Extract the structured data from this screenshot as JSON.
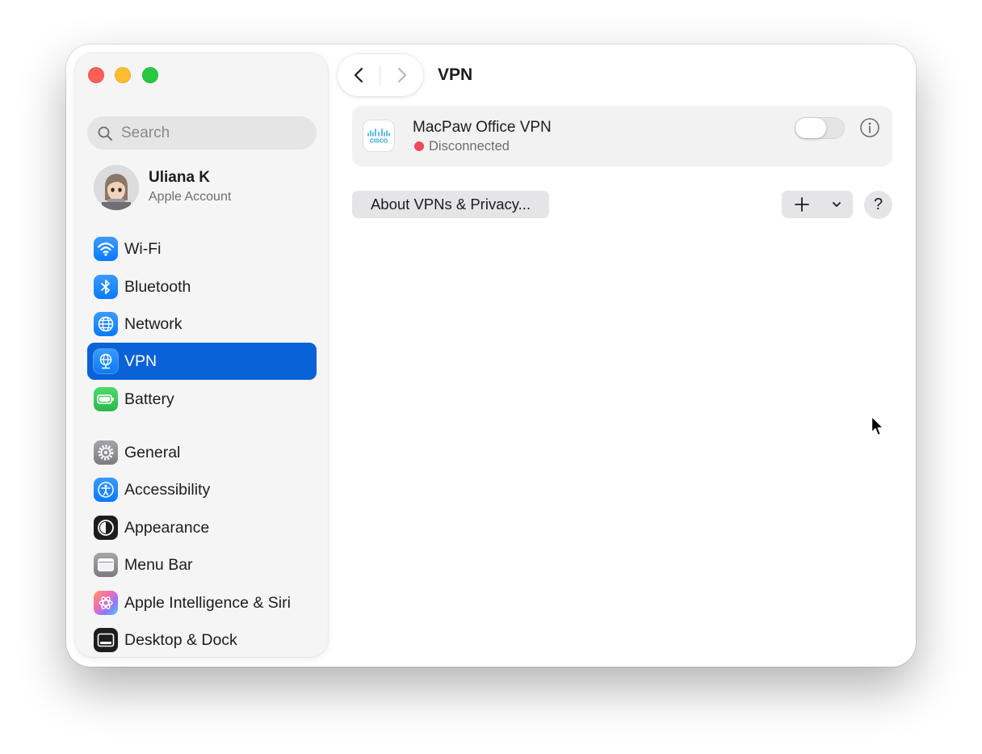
{
  "sidebar": {
    "search_placeholder": "Search",
    "profile": {
      "name": "Uliana K",
      "subtitle": "Apple Account"
    },
    "items": [
      {
        "label": "Wi-Fi",
        "icon": "wifi-icon",
        "color": "#0a84ff"
      },
      {
        "label": "Bluetooth",
        "icon": "bluetooth-icon",
        "color": "#0a84ff"
      },
      {
        "label": "Network",
        "icon": "globe-icon",
        "color": "#0a84ff"
      },
      {
        "label": "VPN",
        "icon": "vpn-globe-icon",
        "color": "#0a84ff",
        "selected": true
      },
      {
        "label": "Battery",
        "icon": "battery-icon",
        "color": "#34c759"
      },
      {
        "label": "General",
        "icon": "gear-icon",
        "color": "#8e8e93"
      },
      {
        "label": "Accessibility",
        "icon": "accessibility-icon",
        "color": "#0a84ff"
      },
      {
        "label": "Appearance",
        "icon": "appearance-icon",
        "color": "#1d1d1f"
      },
      {
        "label": "Menu Bar",
        "icon": "menu-bar-icon",
        "color": "#8e8e93"
      },
      {
        "label": "Apple Intelligence & Siri",
        "icon": "siri-icon",
        "color": "#e8a0d8"
      },
      {
        "label": "Desktop & Dock",
        "icon": "dock-icon",
        "color": "#1d1d1f"
      }
    ],
    "selected_color": "#0a62d8"
  },
  "header": {
    "title": "VPN"
  },
  "vpn": {
    "name": "MacPaw Office VPN",
    "status": "Disconnected",
    "status_color": "#f14a5b",
    "logo_text": "CISCO",
    "enabled": false
  },
  "actions": {
    "about_label": "About VPNs & Privacy...",
    "add_label": "+",
    "help_label": "?"
  }
}
